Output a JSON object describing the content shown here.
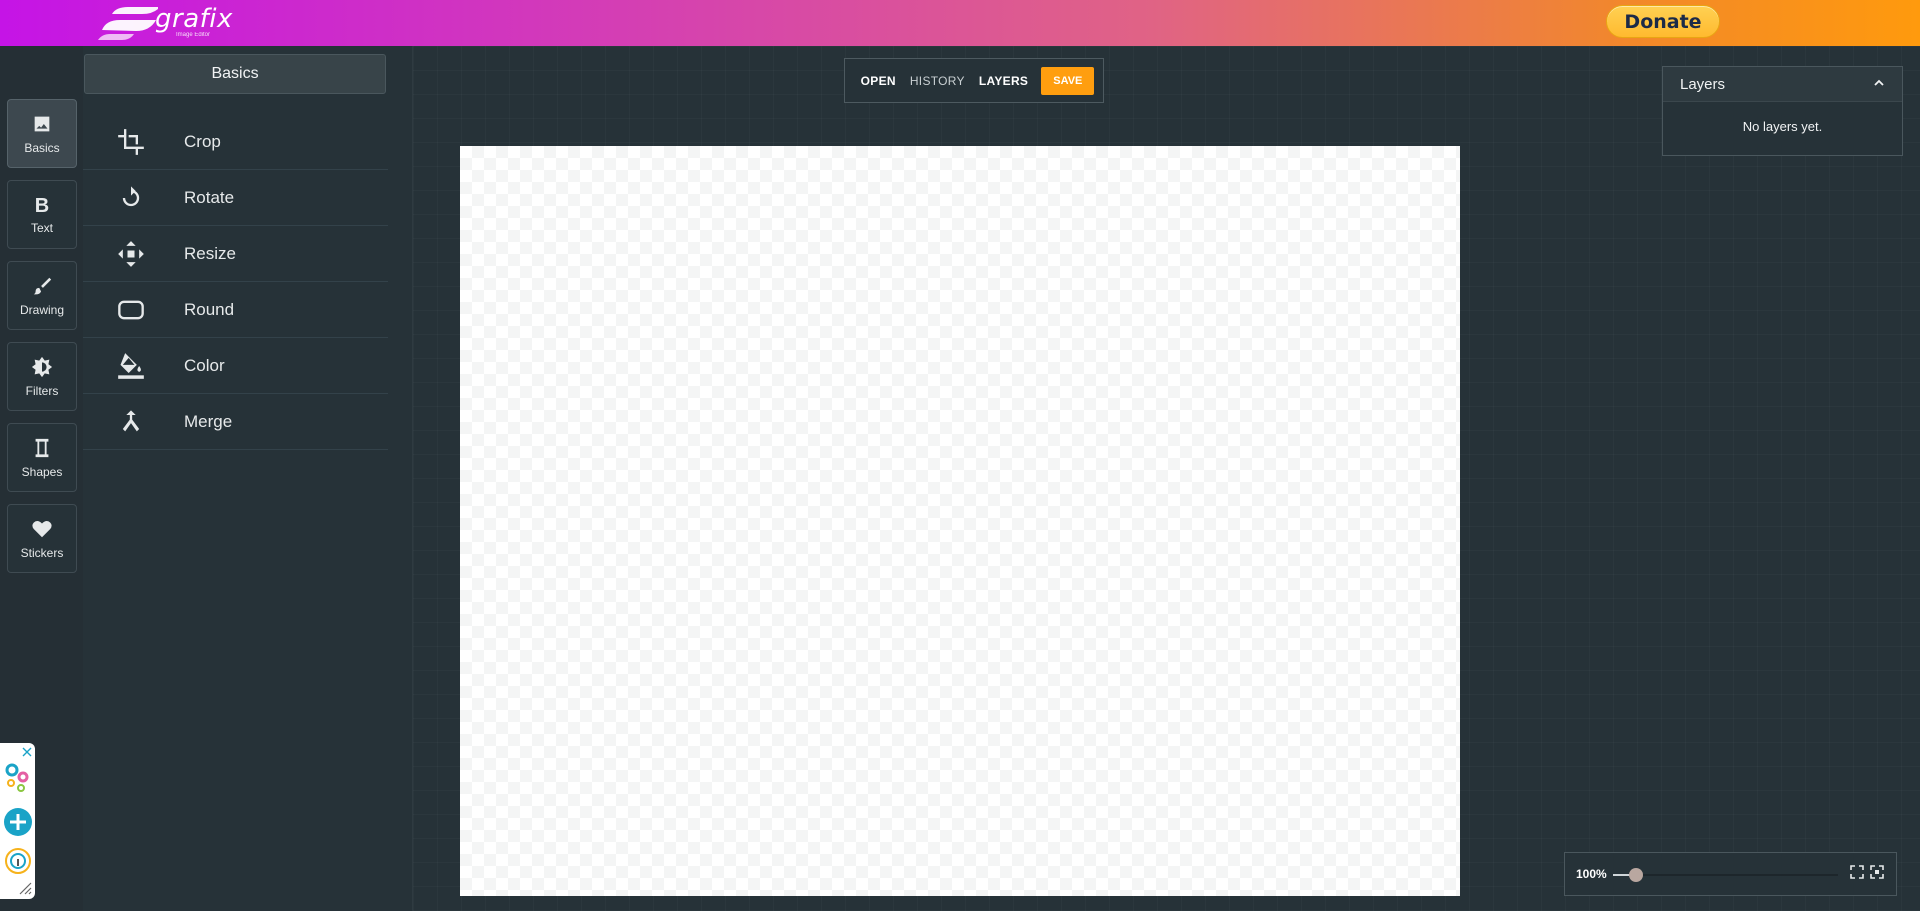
{
  "header": {
    "logo_text": "grafix",
    "logo_subtitle": "Image Editor",
    "donate_label": "Donate"
  },
  "rail": [
    {
      "label": "Basics",
      "icon": "image-icon",
      "active": true
    },
    {
      "label": "Text",
      "icon": "bold-b-icon",
      "active": false
    },
    {
      "label": "Drawing",
      "icon": "brush-icon",
      "active": false
    },
    {
      "label": "Filters",
      "icon": "brightness-icon",
      "active": false
    },
    {
      "label": "Shapes",
      "icon": "shape-icon",
      "active": false
    },
    {
      "label": "Stickers",
      "icon": "heart-icon",
      "active": false
    }
  ],
  "panel": {
    "title": "Basics",
    "tools": [
      {
        "label": "Crop",
        "icon": "crop-icon"
      },
      {
        "label": "Rotate",
        "icon": "rotate-icon"
      },
      {
        "label": "Resize",
        "icon": "resize-icon"
      },
      {
        "label": "Round",
        "icon": "rounded-rect-icon"
      },
      {
        "label": "Color",
        "icon": "paint-bucket-icon"
      },
      {
        "label": "Merge",
        "icon": "merge-icon"
      }
    ]
  },
  "topmenu": {
    "open": "OPEN",
    "history": "HISTORY",
    "layers": "LAYERS",
    "save": "SAVE"
  },
  "layers_panel": {
    "title": "Layers",
    "empty_text": "No layers yet."
  },
  "zoom": {
    "label": "100%",
    "level": 0.1
  },
  "colors": {
    "accent": "#ff9e0f",
    "background": "#263238",
    "donate": "#ffc439"
  }
}
